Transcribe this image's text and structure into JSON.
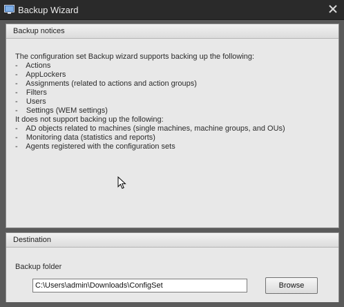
{
  "window": {
    "title": "Backup Wizard"
  },
  "notices": {
    "header": "Backup notices",
    "lines": [
      "The configuration set Backup wizard supports backing up the following:",
      "-    Actions",
      "-    AppLockers",
      "-    Assignments (related to actions and action groups)",
      "-    Filters",
      "-    Users",
      "-    Settings (WEM settings)",
      "It does not support backing up the following:",
      "-    AD objects related to machines (single machines, machine groups, and OUs)",
      "-    Monitoring data (statistics and reports)",
      "-    Agents registered with the configuration sets"
    ]
  },
  "destination": {
    "header": "Destination",
    "folder_label": "Backup folder",
    "folder_value": "C:\\Users\\admin\\Downloads\\ConfigSet",
    "browse_label": "Browse"
  },
  "icons": {
    "app": "monitor-icon",
    "close": "close-icon",
    "cursor": "mouse-cursor-icon"
  }
}
